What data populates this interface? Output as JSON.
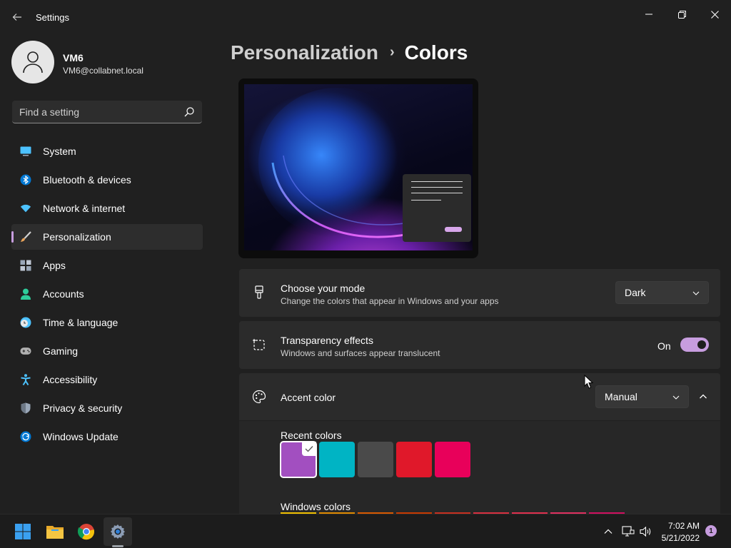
{
  "app": {
    "title": "Settings"
  },
  "user": {
    "name": "VM6",
    "email": "VM6@collabnet.local"
  },
  "search": {
    "placeholder": "Find a setting"
  },
  "nav": [
    {
      "label": "System",
      "icon": "monitor-icon",
      "color": "#4cc2ff"
    },
    {
      "label": "Bluetooth & devices",
      "icon": "bluetooth-icon",
      "color": "#0078d4"
    },
    {
      "label": "Network & internet",
      "icon": "wifi-icon",
      "color": "#4cc2ff"
    },
    {
      "label": "Personalization",
      "icon": "brush-icon",
      "color": "#e8a35a",
      "active": true
    },
    {
      "label": "Apps",
      "icon": "apps-icon",
      "color": "#9aa7b8"
    },
    {
      "label": "Accounts",
      "icon": "person-icon",
      "color": "#2ecc9a"
    },
    {
      "label": "Time & language",
      "icon": "globe-clock-icon",
      "color": "#4cc2ff"
    },
    {
      "label": "Gaming",
      "icon": "gamepad-icon",
      "color": "#b0b0b0"
    },
    {
      "label": "Accessibility",
      "icon": "accessibility-icon",
      "color": "#4cc2ff"
    },
    {
      "label": "Privacy & security",
      "icon": "shield-icon",
      "color": "#9aa7b8"
    },
    {
      "label": "Windows Update",
      "icon": "sync-icon",
      "color": "#0078d4"
    }
  ],
  "breadcrumb": {
    "parent": "Personalization",
    "separator": "›",
    "current": "Colors"
  },
  "mode": {
    "title": "Choose your mode",
    "description": "Change the colors that appear in Windows and your apps",
    "value": "Dark"
  },
  "transparency": {
    "title": "Transparency effects",
    "description": "Windows and surfaces appear translucent",
    "state_label": "On",
    "enabled": true
  },
  "accent": {
    "title": "Accent color",
    "value": "Manual",
    "recent_label": "Recent colors",
    "recent_colors": [
      "#a24fc0",
      "#00b4c4",
      "#4a4a4a",
      "#e0182a",
      "#e8005a"
    ],
    "selected_index": 0,
    "windows_label": "Windows colors",
    "windows_colors": [
      "#f0c000",
      "#e08a00",
      "#d85a00",
      "#c83a00",
      "#c83020",
      "#d83040",
      "#e0304e",
      "#e03060",
      "#d01060"
    ]
  },
  "taskbar": {
    "apps": [
      "windows-start-icon",
      "file-explorer-icon",
      "chrome-icon",
      "settings-gear-icon"
    ],
    "time": "7:02 AM",
    "date": "5/21/2022",
    "notification_count": "1"
  },
  "colors": {
    "accent": "#c79ddf",
    "background": "#202020",
    "card": "#2b2b2b"
  }
}
